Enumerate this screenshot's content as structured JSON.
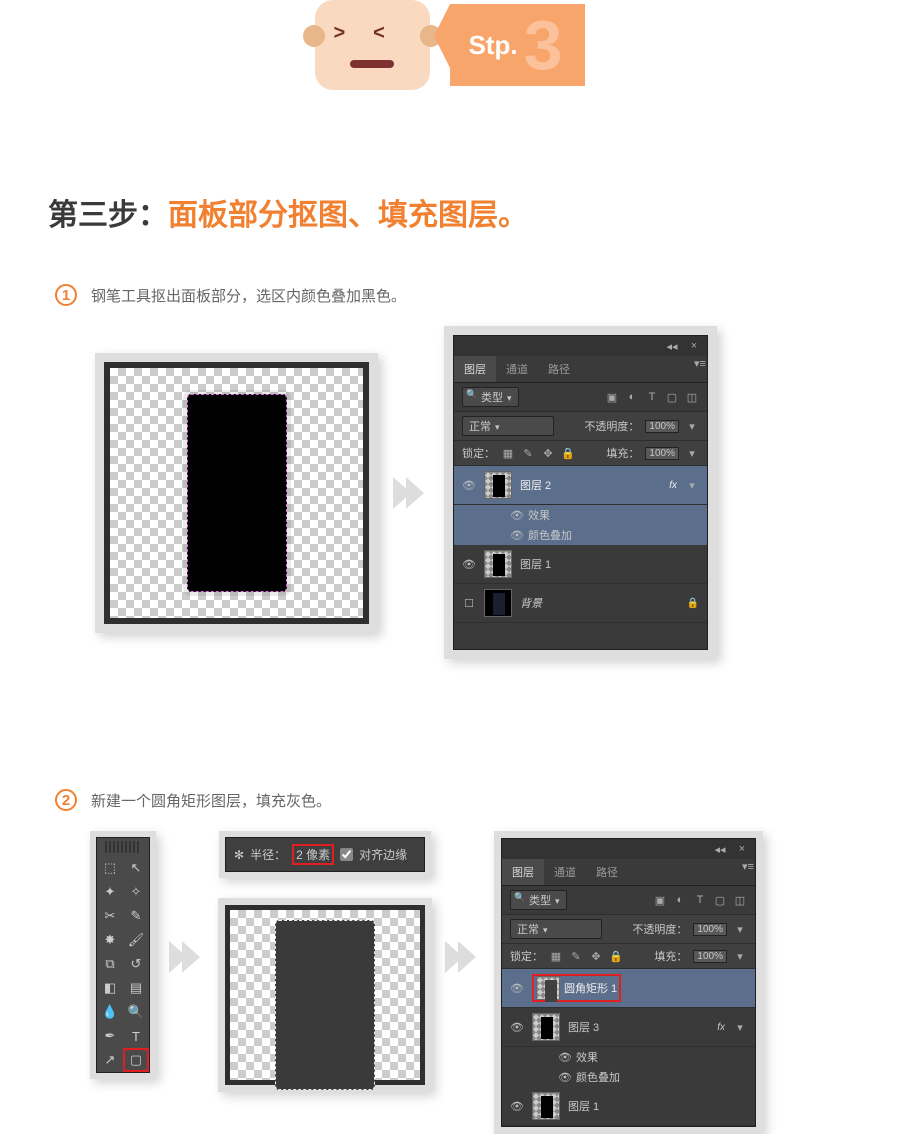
{
  "step_badge": {
    "label": "Stp.",
    "number": "3"
  },
  "heading": {
    "prefix": "第三步：",
    "main": "面板部分抠图、填充图层。"
  },
  "step1": {
    "num": "1",
    "text": "钢笔工具抠出面板部分，选区内颜色叠加黑色。",
    "panel": {
      "tabs": {
        "layers": "图层",
        "channels": "通道",
        "paths": "路径"
      },
      "kind": "类型",
      "blend": "正常",
      "opacity_label": "不透明度：",
      "opacity_val": "100%",
      "lock_label": "锁定：",
      "fill_label": "填充：",
      "fill_val": "100%",
      "layer2": "图层 2",
      "fx": "fx",
      "effects": "效果",
      "color_overlay": "颜色叠加",
      "layer1": "图层 1",
      "background": "背景"
    }
  },
  "step2": {
    "num": "2",
    "text": "新建一个圆角矩形图层，填充灰色。",
    "optbar": {
      "radius_label": "半径：",
      "radius_value": "2 像素",
      "align_label": "对齐边缘"
    },
    "panel": {
      "tabs": {
        "layers": "图层",
        "channels": "通道",
        "paths": "路径"
      },
      "kind": "类型",
      "blend": "正常",
      "opacity_label": "不透明度：",
      "opacity_val": "100%",
      "lock_label": "锁定：",
      "fill_label": "填充：",
      "fill_val": "100%",
      "rrect": "圆角矩形 1",
      "layer3": "图层 3",
      "fx": "fx",
      "effects": "效果",
      "color_overlay": "颜色叠加",
      "layer1": "图层 1"
    }
  }
}
